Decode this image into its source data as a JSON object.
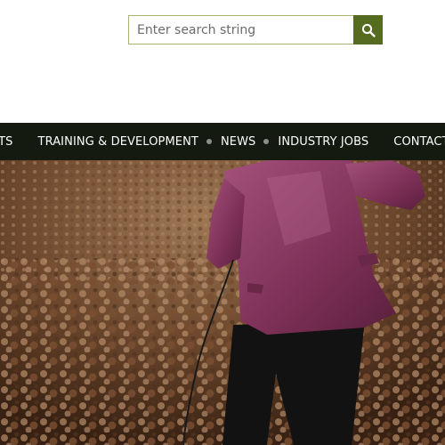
{
  "search": {
    "placeholder": "Enter search string",
    "button_icon": "search-icon"
  },
  "nav": {
    "items": [
      {
        "label": "ENTS"
      },
      {
        "label": "TRAINING & DEVELOPMENT"
      },
      {
        "label": "NEWS"
      },
      {
        "label": "INDUSTRY JOBS"
      },
      {
        "label": "CONTACT"
      }
    ]
  },
  "colors": {
    "accent": "#556b1f",
    "nav_background": "#141a0f",
    "nav_text": "#ffffff",
    "search_border": "#a9b37a"
  },
  "hero": {
    "image": "performer-on-stage-with-crowd"
  }
}
